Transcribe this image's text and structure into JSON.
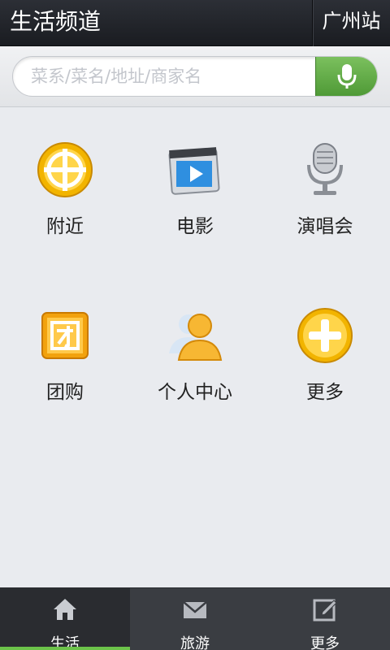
{
  "header": {
    "title": "生活频道",
    "city": "广州站"
  },
  "search": {
    "placeholder": "菜系/菜名/地址/商家名",
    "mic_icon": "microphone-icon"
  },
  "grid": {
    "items": [
      {
        "label": "附近",
        "icon": "crosshair-icon"
      },
      {
        "label": "电影",
        "icon": "movie-icon"
      },
      {
        "label": "演唱会",
        "icon": "microphone-icon"
      },
      {
        "label": "团购",
        "icon": "group-buy-icon"
      },
      {
        "label": "个人中心",
        "icon": "user-icon"
      },
      {
        "label": "更多",
        "icon": "plus-icon"
      }
    ]
  },
  "tabbar": {
    "tabs": [
      {
        "label": "生活",
        "icon": "home-icon",
        "active": true
      },
      {
        "label": "旅游",
        "icon": "mail-icon",
        "active": false
      },
      {
        "label": "更多",
        "icon": "edit-icon",
        "active": false
      }
    ]
  },
  "colors": {
    "accent_green": "#6cc34a",
    "header_bg": "#1a1c21",
    "icon_yellow": "#f5c518"
  }
}
